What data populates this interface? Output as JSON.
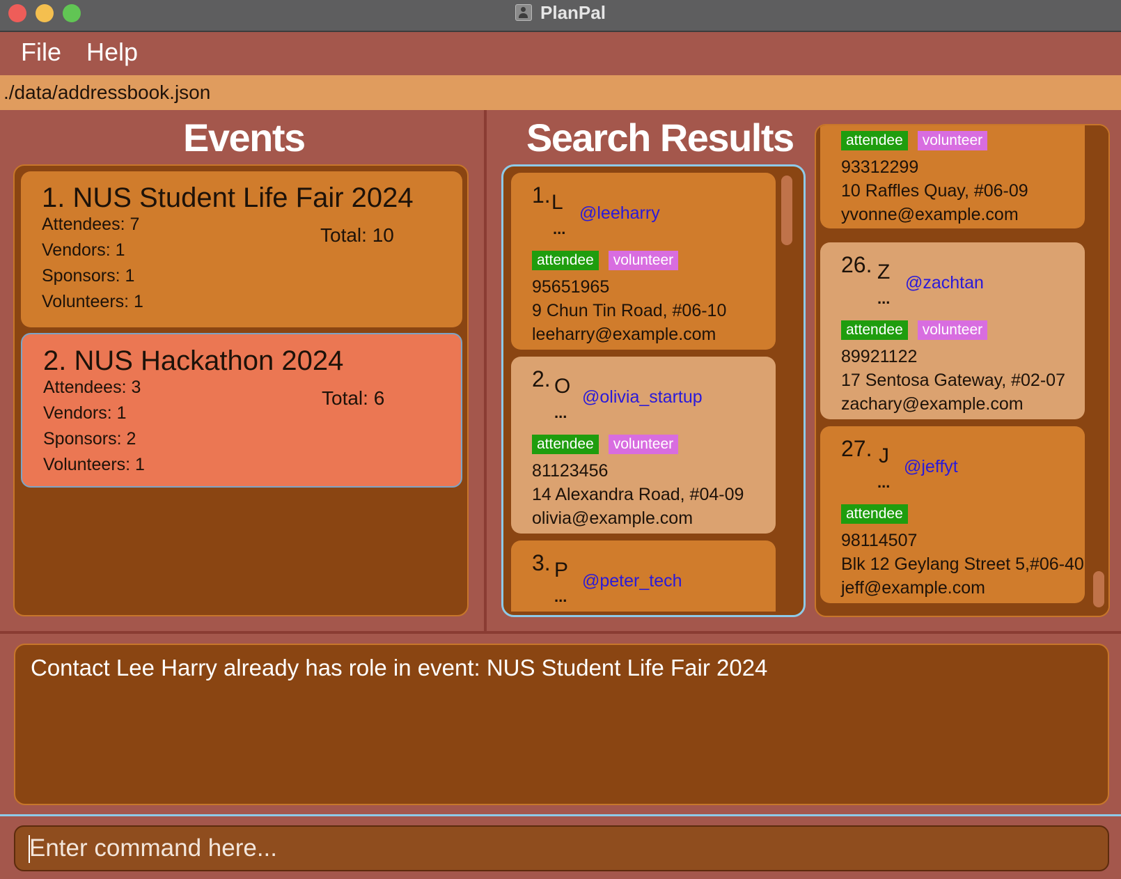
{
  "window": {
    "title": "PlanPal"
  },
  "menu": {
    "file": "File",
    "help": "Help"
  },
  "status": {
    "path": "./data/addressbook.json"
  },
  "events": {
    "title": "Events",
    "items": [
      {
        "name": "1. NUS Student Life Fair 2024",
        "attendees": "Attendees: 7",
        "vendors": "Vendors: 1",
        "sponsors": "Sponsors: 1",
        "volunteers": "Volunteers: 1",
        "total": "Total: 10"
      },
      {
        "name": "2. NUS Hackathon 2024",
        "attendees": "Attendees: 3",
        "vendors": "Vendors: 1",
        "sponsors": "Sponsors: 2",
        "volunteers": "Volunteers: 1",
        "total": "Total: 6"
      }
    ]
  },
  "search": {
    "title": "Search Results",
    "items": [
      {
        "index": "1.",
        "letter": "L",
        "dots": "...",
        "handle": "@leeharry",
        "tags": [
          "attendee",
          "volunteer"
        ],
        "phone": "95651965",
        "address": "9 Chun Tin Road, #06-10",
        "email": "leeharry@example.com"
      },
      {
        "index": "2.",
        "letter": "O",
        "dots": "...",
        "handle": "@olivia_startup",
        "tags": [
          "attendee",
          "volunteer"
        ],
        "phone": "81123456",
        "address": "14 Alexandra Road, #04-09",
        "email": "olivia@example.com"
      },
      {
        "index": "3.",
        "letter": "P",
        "dots": "...",
        "handle": "@peter_tech"
      }
    ]
  },
  "contacts": {
    "items": [
      {
        "tags": [
          "attendee",
          "volunteer"
        ],
        "phone": "93312299",
        "address": "10 Raffles Quay, #06-09",
        "email": "yvonne@example.com"
      },
      {
        "index": "26.",
        "letter": "Z",
        "dots": "...",
        "handle": "@zachtan",
        "tags": [
          "attendee",
          "volunteer"
        ],
        "phone": "89921122",
        "address": "17 Sentosa Gateway, #02-07",
        "email": "zachary@example.com"
      },
      {
        "index": "27.",
        "letter": "J",
        "dots": "...",
        "handle": "@jeffyt",
        "tags": [
          "attendee"
        ],
        "phone": "98114507",
        "address": "Blk 12 Geylang Street 5,#06-40",
        "email": "jeff@example.com"
      }
    ]
  },
  "result": {
    "message": "Contact Lee Harry already has role in event: NUS Student Life Fair 2024"
  },
  "command": {
    "placeholder": "Enter command here...",
    "value": ""
  },
  "colors": {
    "background": "#A4574C",
    "status_bar": "#E09C5E",
    "panel": "#8A4512",
    "card_dark": "#D07C2C",
    "card_light": "#DBA270",
    "event_selected": "#EB7753",
    "tag_attendee": "#1F9D0E",
    "tag_volunteer": "#D86DE0",
    "handle_text": "#2A1AD9",
    "focus_border": "#8ECAE8"
  }
}
